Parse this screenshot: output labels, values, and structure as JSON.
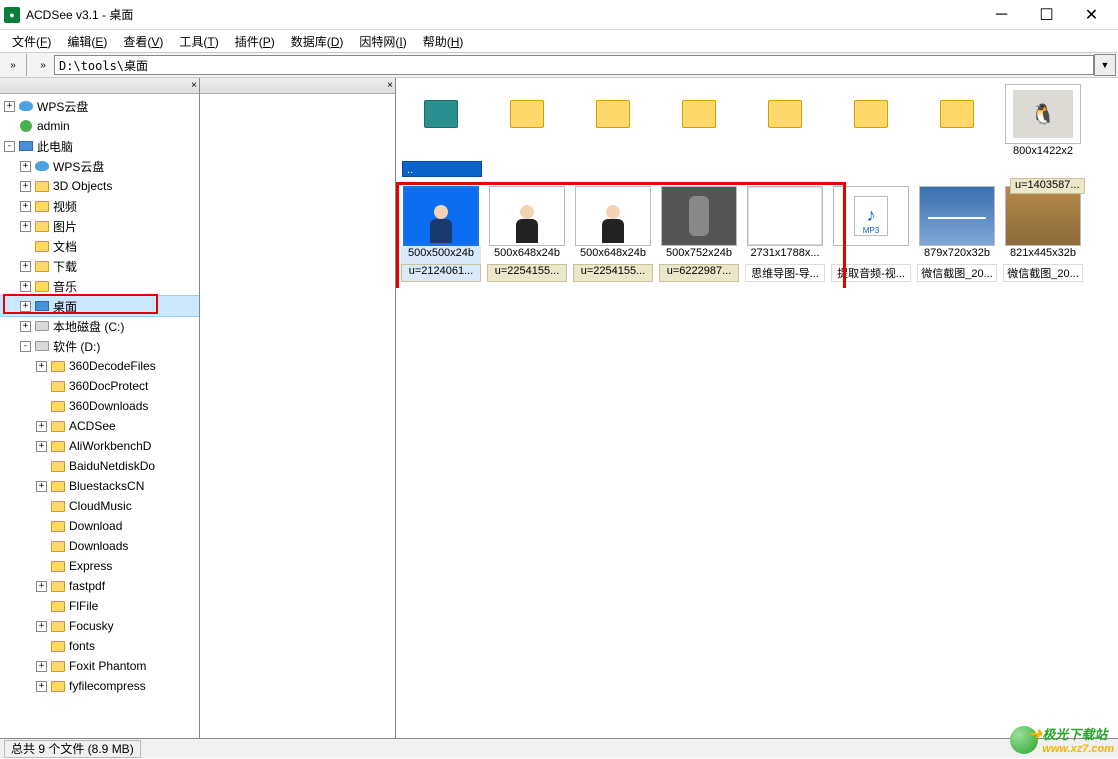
{
  "window": {
    "title": "ACDSee v3.1 - 桌面"
  },
  "menu": [
    {
      "label": "文件",
      "hot": "F"
    },
    {
      "label": "编辑",
      "hot": "E"
    },
    {
      "label": "查看",
      "hot": "V"
    },
    {
      "label": "工具",
      "hot": "T"
    },
    {
      "label": "插件",
      "hot": "P"
    },
    {
      "label": "数据库",
      "hot": "D"
    },
    {
      "label": "因特网",
      "hot": "I"
    },
    {
      "label": "帮助",
      "hot": "H"
    }
  ],
  "path": "D:\\tools\\桌面",
  "tree": [
    {
      "indent": 0,
      "toggle": "+",
      "icon": "cloud",
      "label": "WPS云盘"
    },
    {
      "indent": 0,
      "toggle": "",
      "icon": "user",
      "label": "admin"
    },
    {
      "indent": 0,
      "toggle": "-",
      "icon": "pc",
      "label": "此电脑"
    },
    {
      "indent": 1,
      "toggle": "+",
      "icon": "cloud",
      "label": "WPS云盘"
    },
    {
      "indent": 1,
      "toggle": "+",
      "icon": "folder",
      "label": "3D Objects"
    },
    {
      "indent": 1,
      "toggle": "+",
      "icon": "folder",
      "label": "视频"
    },
    {
      "indent": 1,
      "toggle": "+",
      "icon": "folder",
      "label": "图片"
    },
    {
      "indent": 1,
      "toggle": "",
      "icon": "folder",
      "label": "文档"
    },
    {
      "indent": 1,
      "toggle": "+",
      "icon": "folder",
      "label": "下载"
    },
    {
      "indent": 1,
      "toggle": "+",
      "icon": "folder",
      "label": "音乐"
    },
    {
      "indent": 1,
      "toggle": "+",
      "icon": "pc",
      "label": "桌面",
      "selected": true
    },
    {
      "indent": 1,
      "toggle": "+",
      "icon": "drive",
      "label": "本地磁盘 (C:)"
    },
    {
      "indent": 1,
      "toggle": "-",
      "icon": "drive",
      "label": "软件 (D:)"
    },
    {
      "indent": 2,
      "toggle": "+",
      "icon": "folder",
      "label": "360DecodeFiles"
    },
    {
      "indent": 2,
      "toggle": "",
      "icon": "folder",
      "label": "360DocProtect"
    },
    {
      "indent": 2,
      "toggle": "",
      "icon": "folder",
      "label": "360Downloads"
    },
    {
      "indent": 2,
      "toggle": "+",
      "icon": "folder",
      "label": "ACDSee"
    },
    {
      "indent": 2,
      "toggle": "+",
      "icon": "folder",
      "label": "AliWorkbenchD"
    },
    {
      "indent": 2,
      "toggle": "",
      "icon": "folder",
      "label": "BaiduNetdiskDo"
    },
    {
      "indent": 2,
      "toggle": "+",
      "icon": "folder",
      "label": "BluestacksCN"
    },
    {
      "indent": 2,
      "toggle": "",
      "icon": "folder",
      "label": "CloudMusic"
    },
    {
      "indent": 2,
      "toggle": "",
      "icon": "folder",
      "label": "Download"
    },
    {
      "indent": 2,
      "toggle": "",
      "icon": "folder",
      "label": "Downloads"
    },
    {
      "indent": 2,
      "toggle": "",
      "icon": "folder",
      "label": "Express"
    },
    {
      "indent": 2,
      "toggle": "+",
      "icon": "folder",
      "label": "fastpdf"
    },
    {
      "indent": 2,
      "toggle": "",
      "icon": "folder",
      "label": "FlFile"
    },
    {
      "indent": 2,
      "toggle": "+",
      "icon": "folder",
      "label": "Focusky"
    },
    {
      "indent": 2,
      "toggle": "",
      "icon": "folder",
      "label": "fonts"
    },
    {
      "indent": 2,
      "toggle": "+",
      "icon": "folder",
      "label": "Foxit Phantom"
    },
    {
      "indent": 2,
      "toggle": "+",
      "icon": "folder",
      "label": "fyfilecompress"
    }
  ],
  "folder_row_name_far_right": "u=1403587...",
  "folder_dim_far_right": "800x1422x2",
  "thumbs": [
    {
      "kind": "portrait-blue",
      "dim": "500x500x24b",
      "name": "u=2124061...",
      "sel": true
    },
    {
      "kind": "portrait-white",
      "dim": "500x648x24b",
      "name": "u=2254155...",
      "sel": false
    },
    {
      "kind": "portrait-white",
      "dim": "500x648x24b",
      "name": "u=2254155...",
      "sel": false
    },
    {
      "kind": "sculpt",
      "dim": "500x752x24b",
      "name": "u=6222987...",
      "sel": false
    },
    {
      "kind": "mindmap",
      "dim": "2731x1788x...",
      "name": "思维导图-导...",
      "sel": false,
      "plainname": true
    },
    {
      "kind": "mp3",
      "dim": "",
      "name": "提取音频-视...",
      "sel": false,
      "plainname": true
    },
    {
      "kind": "bridge",
      "dim": "879x720x32b",
      "name": "微信截图_20...",
      "sel": false,
      "plainname": true
    },
    {
      "kind": "city",
      "dim": "821x445x32b",
      "name": "微信截图_20...",
      "sel": false,
      "plainname": true
    }
  ],
  "status": "总共 9 个文件 (8.9 MB)",
  "watermark_text": "极光下载站",
  "watermark_url": "www.xz7.com"
}
